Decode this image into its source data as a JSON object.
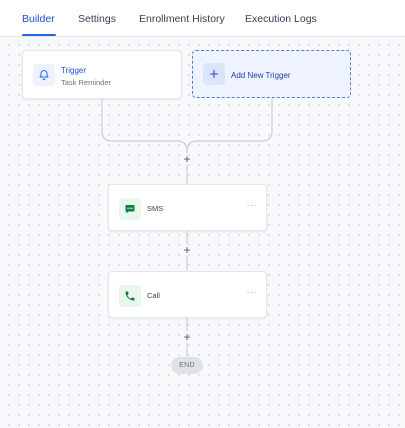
{
  "tabs": [
    {
      "label": "Builder",
      "active": true
    },
    {
      "label": "Settings",
      "active": false
    },
    {
      "label": "Enrollment History",
      "active": false
    },
    {
      "label": "Execution Logs",
      "active": false
    }
  ],
  "workflow": {
    "trigger": {
      "title": "Trigger",
      "subtitle": "Task Reminder",
      "icon": "bell-icon"
    },
    "add_trigger": {
      "label": "Add New Trigger",
      "icon": "plus-icon"
    },
    "actions": [
      {
        "label": "SMS",
        "icon": "chat-icon",
        "menu": "···"
      },
      {
        "label": "Call",
        "icon": "phone-icon",
        "menu": "···"
      }
    ],
    "add_step_symbol": "+",
    "end_label": "END"
  },
  "colors": {
    "accent": "#2563eb",
    "action_icon": "#15803d",
    "connector": "#c9ced6"
  }
}
